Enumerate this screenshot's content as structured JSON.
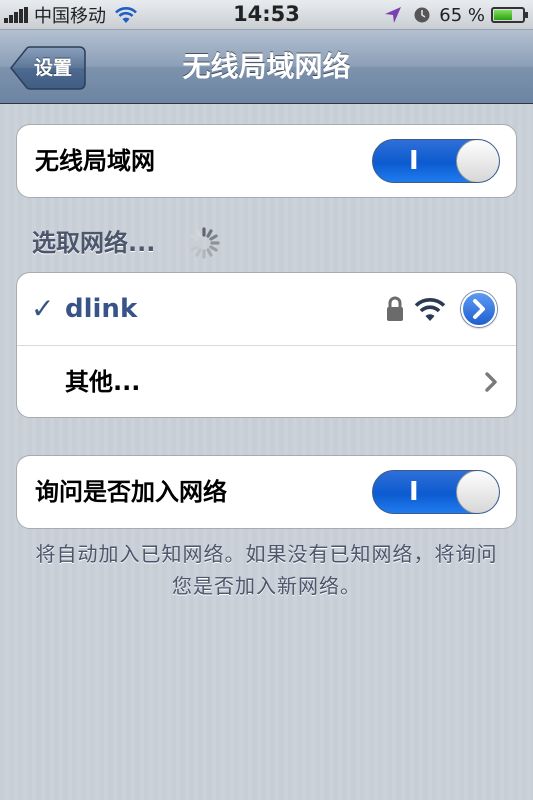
{
  "status_bar": {
    "carrier": "中国移动",
    "time": "14:53",
    "battery_percent": "65 %",
    "battery_level": 0.65,
    "icons": [
      "signal-bars-icon",
      "wifi-icon",
      "location-arrow-icon",
      "alarm-clock-icon",
      "battery-charging-icon"
    ]
  },
  "nav": {
    "back_label": "设置",
    "title": "无线局域网络"
  },
  "wifi_toggle": {
    "label": "无线局域网",
    "switch_text": "I",
    "on": true
  },
  "choose_network": {
    "title": "选取网络..."
  },
  "networks": [
    {
      "name": "dlink",
      "selected": true,
      "secured": true,
      "check": "✓"
    }
  ],
  "other": {
    "label": "其他..."
  },
  "ask_to_join": {
    "label": "询问是否加入网络",
    "switch_text": "I",
    "on": true
  },
  "footnote": {
    "text": "将自动加入已知网络。如果没有已知网络，将询问您是否加入新网络。"
  },
  "colors": {
    "switch_on": "#1466dd",
    "nav_bar": "#7c92ad",
    "selected_network_text": "#385487",
    "section_text": "#4c566c"
  }
}
